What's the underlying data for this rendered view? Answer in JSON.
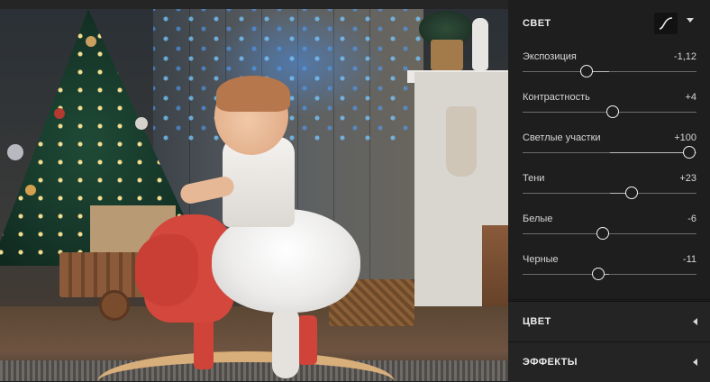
{
  "photo": {
    "description_icon": "photo-preview"
  },
  "panel": {
    "light_section": {
      "title": "СВЕТ",
      "curve_icon": "tone-curve-icon",
      "caret_icon": "chevron-down-icon",
      "sliders": [
        {
          "label": "Экспозиция",
          "value": "-1,12",
          "level": 0.37
        },
        {
          "label": "Контрастность",
          "value": "+4",
          "level": 0.52
        },
        {
          "label": "Светлые участки",
          "value": "+100",
          "level": 0.995
        },
        {
          "label": "Тени",
          "value": "+23",
          "level": 0.63
        },
        {
          "label": "Белые",
          "value": "-6",
          "level": 0.465
        },
        {
          "label": "Черные",
          "value": "-11",
          "level": 0.44
        }
      ]
    },
    "color_section": {
      "title": "ЦВЕТ",
      "caret_icon": "chevron-left-icon"
    },
    "effects_section": {
      "title": "ЭФФЕКТЫ",
      "caret_icon": "chevron-left-icon"
    }
  },
  "colors": {
    "panel_bg": "#1e1e1e",
    "track": "#6b6b6b",
    "thumb_border": "#f0f0f0"
  }
}
